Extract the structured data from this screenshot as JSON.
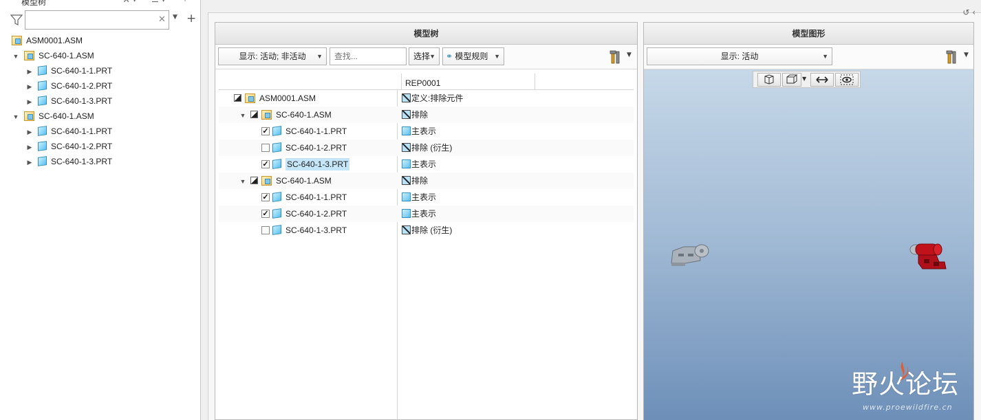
{
  "left_pane": {
    "title": "模型树",
    "filter": {
      "value": "",
      "placeholder": ""
    },
    "tree": [
      {
        "label": "ASM0001.ASM",
        "type": "asm",
        "level": 0,
        "expander": ""
      },
      {
        "label": "SC-640-1.ASM",
        "type": "asm",
        "level": 1,
        "expander": "▼"
      },
      {
        "label": "SC-640-1-1.PRT",
        "type": "prt",
        "level": 2,
        "expander": "▶"
      },
      {
        "label": "SC-640-1-2.PRT",
        "type": "prt",
        "level": 2,
        "expander": "▶"
      },
      {
        "label": "SC-640-1-3.PRT",
        "type": "prt",
        "level": 2,
        "expander": "▶"
      },
      {
        "label": "SC-640-1.ASM",
        "type": "asm",
        "level": 1,
        "expander": "▼"
      },
      {
        "label": "SC-640-1-1.PRT",
        "type": "prt",
        "level": 2,
        "expander": "▶"
      },
      {
        "label": "SC-640-1-2.PRT",
        "type": "prt",
        "level": 2,
        "expander": "▶"
      },
      {
        "label": "SC-640-1-3.PRT",
        "type": "prt",
        "level": 2,
        "expander": "▶"
      }
    ]
  },
  "center_panel": {
    "title": "模型树",
    "toolbar": {
      "display_dropdown": "显示: 活动; 非活动",
      "find_placeholder": "查找...",
      "select_dropdown": "选择",
      "rules_dropdown": "模型规则"
    },
    "column_header": "REP0001",
    "rows": [
      {
        "name": "ASM0001.ASM",
        "type": "asm",
        "expander": "",
        "state": "half",
        "checked": null,
        "rep": "定义:排除元件",
        "rep_icon": "excluded",
        "selected": false
      },
      {
        "name": "SC-640-1.ASM",
        "type": "asm",
        "expander": "▼",
        "state": "half",
        "checked": null,
        "rep": "排除",
        "rep_icon": "excluded",
        "selected": false
      },
      {
        "name": "SC-640-1-1.PRT",
        "type": "prt",
        "expander": "",
        "state": "check",
        "checked": true,
        "rep": "主表示",
        "rep_icon": "master",
        "selected": false
      },
      {
        "name": "SC-640-1-2.PRT",
        "type": "prt",
        "expander": "",
        "state": "check",
        "checked": false,
        "rep": "排除 (衍生)",
        "rep_icon": "excluded",
        "selected": false
      },
      {
        "name": "SC-640-1-3.PRT",
        "type": "prt",
        "expander": "",
        "state": "check",
        "checked": true,
        "rep": "主表示",
        "rep_icon": "master",
        "selected": true
      },
      {
        "name": "SC-640-1.ASM",
        "type": "asm",
        "expander": "▼",
        "state": "half",
        "checked": null,
        "rep": "排除",
        "rep_icon": "excluded",
        "selected": false
      },
      {
        "name": "SC-640-1-1.PRT",
        "type": "prt",
        "expander": "",
        "state": "check",
        "checked": true,
        "rep": "主表示",
        "rep_icon": "master",
        "selected": false
      },
      {
        "name": "SC-640-1-2.PRT",
        "type": "prt",
        "expander": "",
        "state": "check",
        "checked": true,
        "rep": "主表示",
        "rep_icon": "master",
        "selected": false
      },
      {
        "name": "SC-640-1-3.PRT",
        "type": "prt",
        "expander": "",
        "state": "check",
        "checked": false,
        "rep": "排除 (衍生)",
        "rep_icon": "excluded",
        "selected": false
      }
    ]
  },
  "right_panel": {
    "title": "模型图形",
    "display_dropdown": "显示: 活动"
  },
  "watermark": {
    "main": "野火论坛",
    "sub": "www.proewildfire.cn"
  },
  "colors": {
    "selection": "#c5e6f8",
    "viewport_top": "#c6d8e8",
    "viewport_bottom": "#6d8fb8",
    "excluded_part": "#9aa3ad",
    "active_part": "#c0121a"
  }
}
